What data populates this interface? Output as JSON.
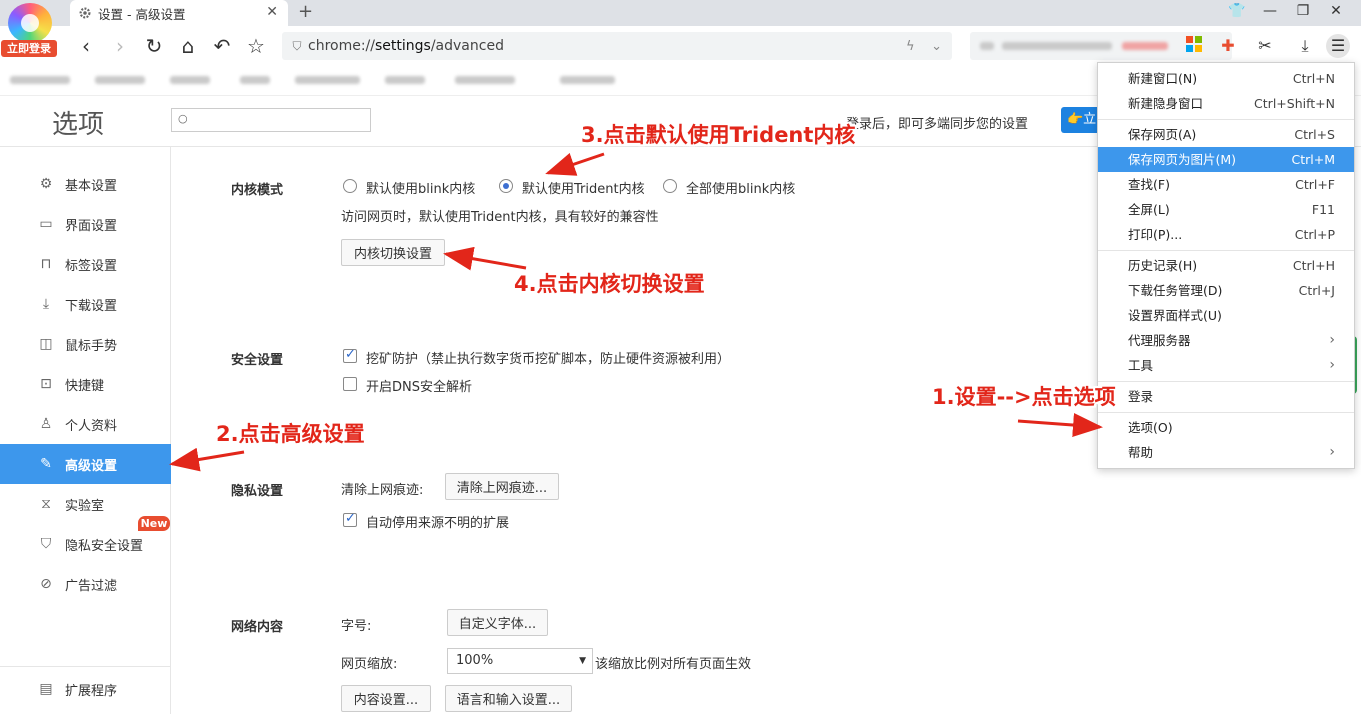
{
  "tab": {
    "title": "设置 - 高级设置",
    "close": "✕"
  },
  "new_tab": "+",
  "window": {
    "skin": "👕",
    "min": "—",
    "max": "❐",
    "close": "✕"
  },
  "login_badge": "立即登录",
  "omnibox": {
    "scheme": "chrome://",
    "host": "settings",
    "path": "/advanced"
  },
  "header": {
    "title": "选项",
    "sync_text": "登录后，即可多端同步您的设置",
    "sync_button": "👉立"
  },
  "sidebar": {
    "items": [
      {
        "label": "基本设置",
        "icon": "gear-icon"
      },
      {
        "label": "界面设置",
        "icon": "window-icon"
      },
      {
        "label": "标签设置",
        "icon": "tab-icon"
      },
      {
        "label": "下载设置",
        "icon": "download-icon"
      },
      {
        "label": "鼠标手势",
        "icon": "mouse-icon"
      },
      {
        "label": "快捷键",
        "icon": "shortcut-icon"
      },
      {
        "label": "个人资料",
        "icon": "user-icon"
      },
      {
        "label": "高级设置",
        "icon": "wrench-icon"
      },
      {
        "label": "实验室",
        "icon": "flask-icon"
      },
      {
        "label": "隐私安全设置",
        "icon": "shield-icon"
      },
      {
        "label": "广告过滤",
        "icon": "block-icon"
      }
    ],
    "new_badge": "New",
    "extensions": "扩展程序"
  },
  "kernel": {
    "label": "内核模式",
    "options": [
      "默认使用blink内核",
      "默认使用Trident内核",
      "全部使用blink内核"
    ],
    "selected": 1,
    "desc": "访问网页时，默认使用Trident内核，具有较好的兼容性",
    "button": "内核切换设置"
  },
  "security": {
    "label": "安全设置",
    "mining": "挖矿防护（禁止执行数字货币挖矿脚本，防止硬件资源被利用）",
    "mining_checked": true,
    "dns": "开启DNS安全解析",
    "dns_checked": false
  },
  "privacy": {
    "label": "隐私设置",
    "clear_label": "清除上网痕迹:",
    "clear_button": "清除上网痕迹...",
    "auto_disable": "自动停用来源不明的扩展",
    "auto_disable_checked": true
  },
  "web_content": {
    "label": "网络内容",
    "font_label": "字号:",
    "font_button": "自定义字体...",
    "zoom_label": "网页缩放:",
    "zoom_value": "100%",
    "zoom_desc": "该缩放比例对所有页面生效",
    "content_button": "内容设置...",
    "lang_button": "语言和输入设置..."
  },
  "menu": {
    "groups": [
      [
        {
          "label": "新建窗口(N)",
          "shortcut": "Ctrl+N"
        },
        {
          "label": "新建隐身窗口",
          "shortcut": "Ctrl+Shift+N"
        }
      ],
      [
        {
          "label": "保存网页(A)",
          "shortcut": "Ctrl+S"
        },
        {
          "label": "保存网页为图片(M)",
          "shortcut": "Ctrl+M"
        },
        {
          "label": "查找(F)",
          "shortcut": "Ctrl+F"
        },
        {
          "label": "全屏(L)",
          "shortcut": "F11"
        },
        {
          "label": "打印(P)...",
          "shortcut": "Ctrl+P"
        }
      ],
      [
        {
          "label": "历史记录(H)",
          "shortcut": "Ctrl+H"
        },
        {
          "label": "下载任务管理(D)",
          "shortcut": "Ctrl+J"
        },
        {
          "label": "设置界面样式(U)",
          "shortcut": ""
        },
        {
          "label": "代理服务器",
          "shortcut": "›"
        },
        {
          "label": "工具",
          "shortcut": "›"
        }
      ],
      [
        {
          "label": "登录",
          "shortcut": ""
        }
      ],
      [
        {
          "label": "选项(O)",
          "shortcut": ""
        },
        {
          "label": "帮助",
          "shortcut": "›"
        }
      ]
    ],
    "highlighted": "保存网页为图片(M)"
  },
  "annotations": {
    "step1": "1.设置-->点击选项",
    "step2": "2.点击高级设置",
    "step3": "3.点击默认使用Trident内核",
    "step4": "4.点击内核切换设置"
  },
  "colors": {
    "accent": "#3d97ec",
    "annotation": "#e2261a",
    "badge": "#e84d30"
  }
}
